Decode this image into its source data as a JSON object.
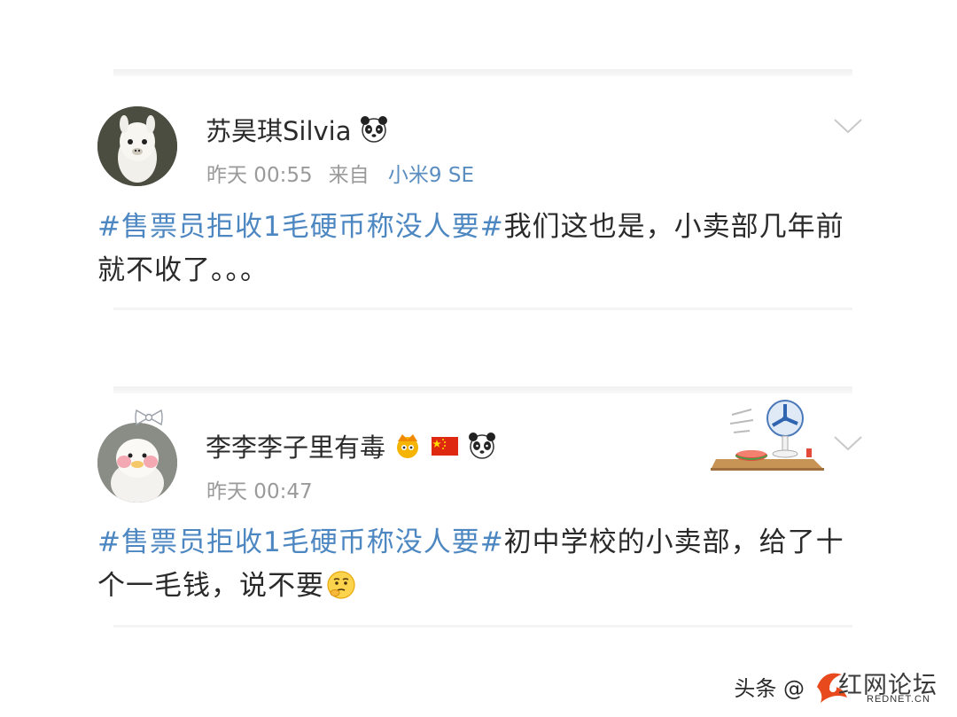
{
  "posts": [
    {
      "username": "苏昊琪Silvia",
      "badges": [
        "panda-icon"
      ],
      "time": "昨天 00:55",
      "source_prefix": "来自",
      "device": "小米9 SE",
      "hashtag": "#售票员拒收1毛硬币称没人要#",
      "body": "我们这也是，小卖部几年前就不收了。。。"
    },
    {
      "username": "李李李子里有毒",
      "badges": [
        "crown-fan-badge-icon",
        "china-flag-icon",
        "panda-icon"
      ],
      "time": "昨天 00:47",
      "hashtag": "#售票员拒收1毛硬币称没人要#",
      "body": "初中学校的小卖部，给了十个一毛钱，说不要",
      "emoji": "thinking-face-icon",
      "decoration": "fan-and-watermelon-sticker"
    }
  ],
  "watermark": {
    "prefix": "头条 @",
    "logo_text": "红网论坛",
    "logo_sub": "REDNET.CN"
  },
  "colors": {
    "hashtag": "#4d87c2",
    "device": "#5a8dc0",
    "meta": "#9a9a9a",
    "watermark_accent": "#e8491d"
  }
}
